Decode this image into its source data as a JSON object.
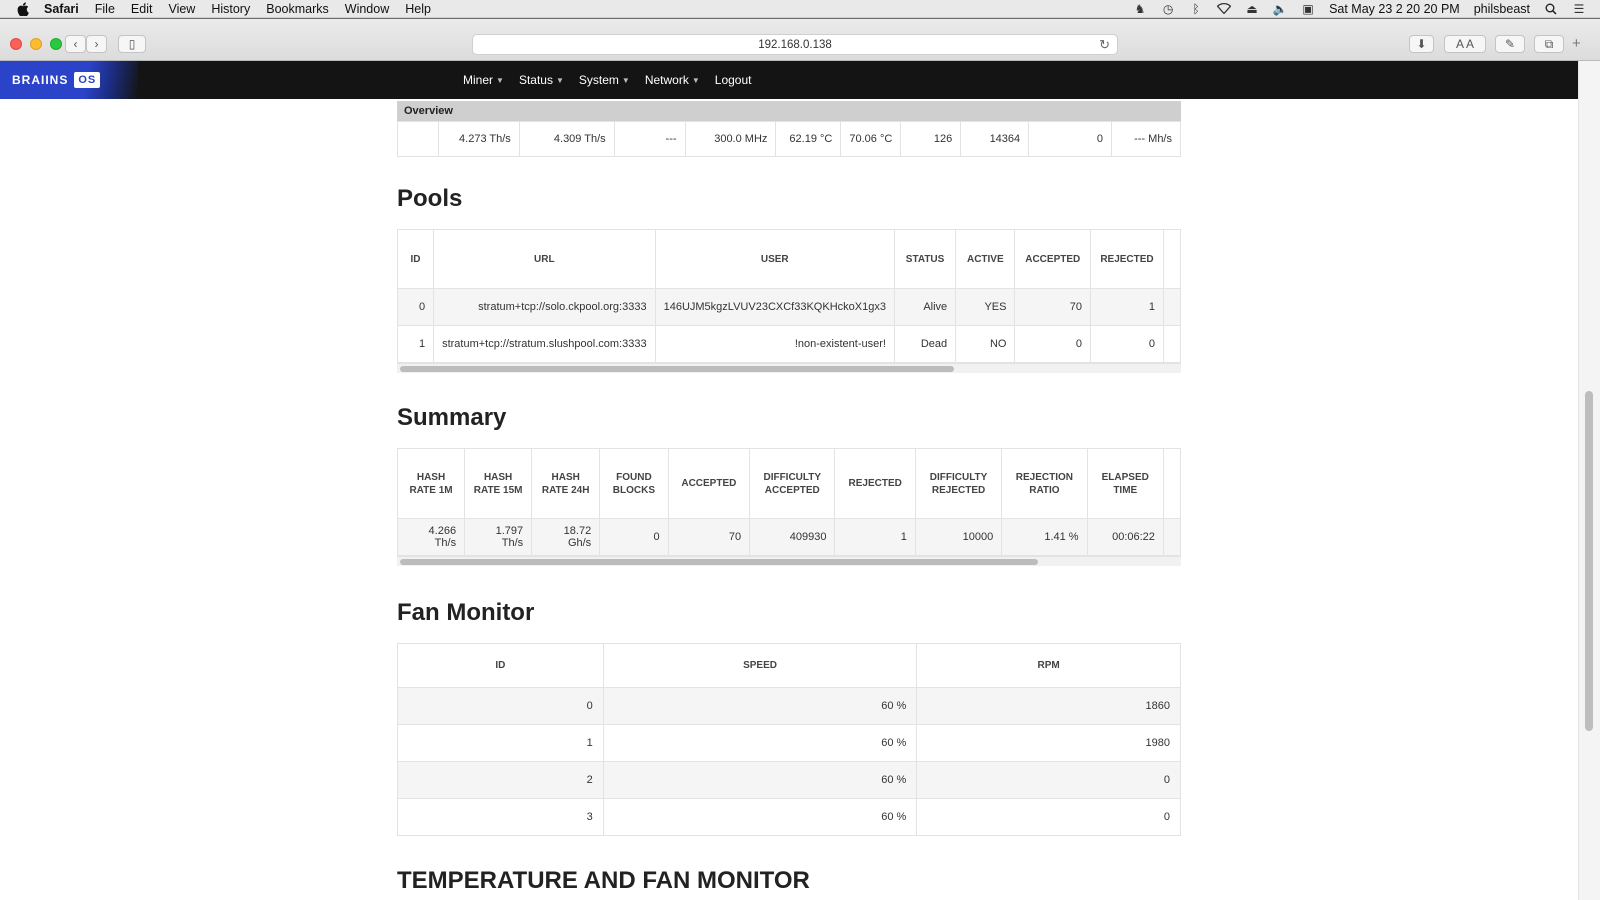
{
  "menubar": {
    "app": "Safari",
    "items": [
      "File",
      "Edit",
      "View",
      "History",
      "Bookmarks",
      "Window",
      "Help"
    ],
    "datetime": "Sat May 23  2 20 20 PM",
    "user": "philsbeast"
  },
  "browser": {
    "url": "192.168.0.138"
  },
  "navbar": {
    "logo_text": "BRAIINS",
    "logo_badge": "OS",
    "menu": [
      "Miner",
      "Status",
      "System",
      "Network",
      "Logout"
    ]
  },
  "overview": {
    "title": "Overview",
    "values": [
      "",
      "4.273 Th/s",
      "4.309 Th/s",
      "---",
      "300.0 MHz",
      "62.19 °C",
      "70.06 °C",
      "126",
      "14364",
      "0",
      "--- Mh/s"
    ]
  },
  "pools": {
    "title": "Pools",
    "headers": [
      "ID",
      "URL",
      "USER",
      "STATUS",
      "ACTIVE",
      "ACCEPTED",
      "REJECTED",
      ""
    ],
    "rows": [
      [
        "0",
        "stratum+tcp://solo.ckpool.org:3333",
        "146UJM5kgzLVUV23CXCf33KQKHckoX1gx3",
        "Alive",
        "YES",
        "70",
        "1",
        ""
      ],
      [
        "1",
        "stratum+tcp://stratum.slushpool.com:3333",
        "!non-existent-user!",
        "Dead",
        "NO",
        "0",
        "0",
        ""
      ]
    ]
  },
  "summary": {
    "title": "Summary",
    "headers": [
      "HASH RATE 1M",
      "HASH RATE 15M",
      "HASH RATE 24H",
      "FOUND BLOCKS",
      "ACCEPTED",
      "DIFFICULTY ACCEPTED",
      "REJECTED",
      "DIFFICULTY REJECTED",
      "REJECTION RATIO",
      "ELAPSED TIME",
      ""
    ],
    "row": [
      "4.266 Th/s",
      "1.797 Th/s",
      "18.72 Gh/s",
      "0",
      "70",
      "409930",
      "1",
      "10000",
      "1.41 %",
      "00:06:22",
      ""
    ]
  },
  "fan_monitor": {
    "title": "Fan Monitor",
    "headers": [
      "ID",
      "SPEED",
      "RPM"
    ],
    "rows": [
      [
        "0",
        "60 %",
        "1860"
      ],
      [
        "1",
        "60 %",
        "1980"
      ],
      [
        "2",
        "60 %",
        "0"
      ],
      [
        "3",
        "60 %",
        "0"
      ]
    ]
  },
  "temp_fan": {
    "title": "TEMPERATURE AND FAN MONITOR"
  }
}
